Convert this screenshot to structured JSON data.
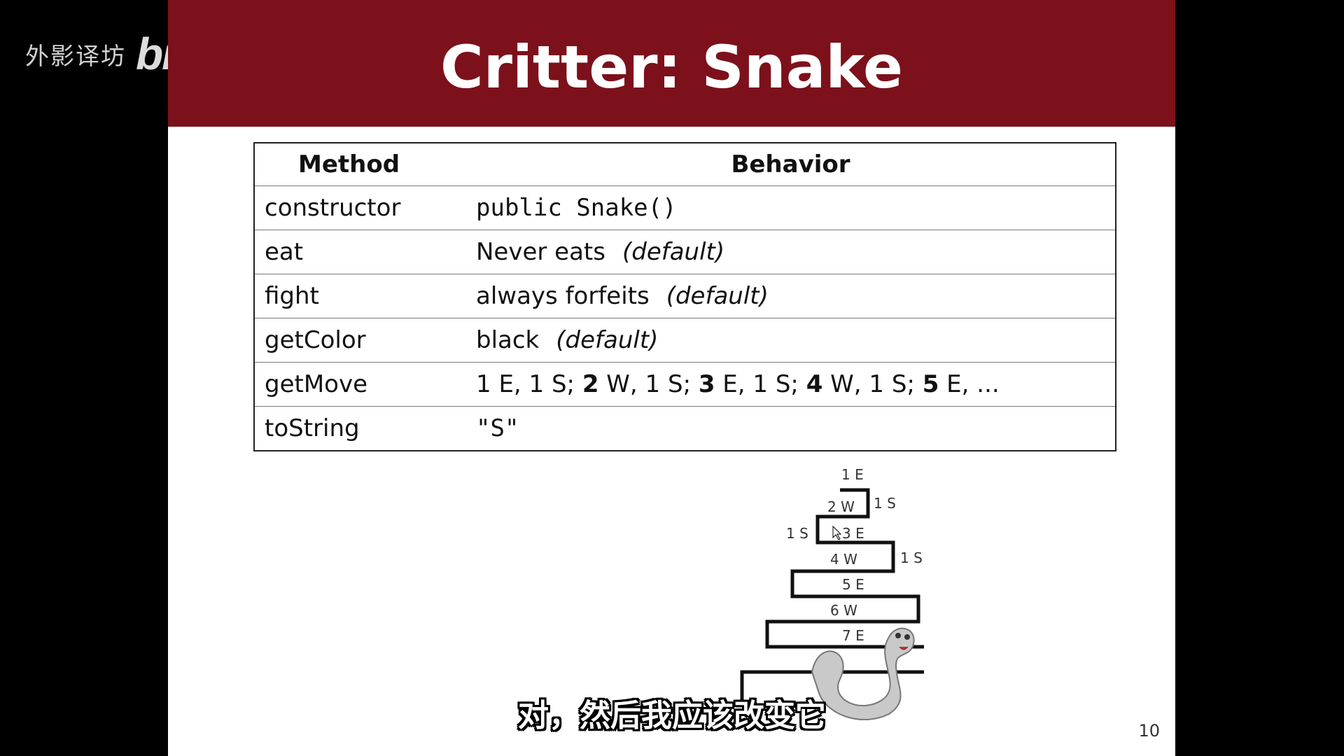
{
  "watermark": {
    "text": "外影译坊",
    "logo": "bilibili"
  },
  "slide": {
    "title": "Critter: Snake",
    "page_number": "10",
    "table": {
      "headers": {
        "method": "Method",
        "behavior": "Behavior"
      },
      "rows": [
        {
          "method": "constructor",
          "behavior": "public Snake()",
          "note": ""
        },
        {
          "method": "eat",
          "behavior": "Never eats",
          "note": "(default)"
        },
        {
          "method": "fight",
          "behavior": "always forfeits",
          "note": "(default)"
        },
        {
          "method": "getColor",
          "behavior": "black",
          "note": "(default)"
        },
        {
          "method": "getMove",
          "behavior_parts": [
            "1 E, 1 S; ",
            "2",
            " W, 1 S; ",
            "3",
            " E, 1 S; ",
            "4",
            " W, 1 S; ",
            "5",
            " E, ..."
          ]
        },
        {
          "method": "toString",
          "behavior": "\"S\"",
          "note": ""
        }
      ]
    },
    "diagram": {
      "labels": {
        "e1": "1 E",
        "s1a": "1 S",
        "w2": "2 W",
        "s1b": "1 S",
        "e3": "3 E",
        "w4": "4 W",
        "s1c": "1 S",
        "e5": "5 E",
        "w6": "6 W",
        "e7": "7 E"
      }
    }
  },
  "subtitle": "对，然后我应该改变它"
}
